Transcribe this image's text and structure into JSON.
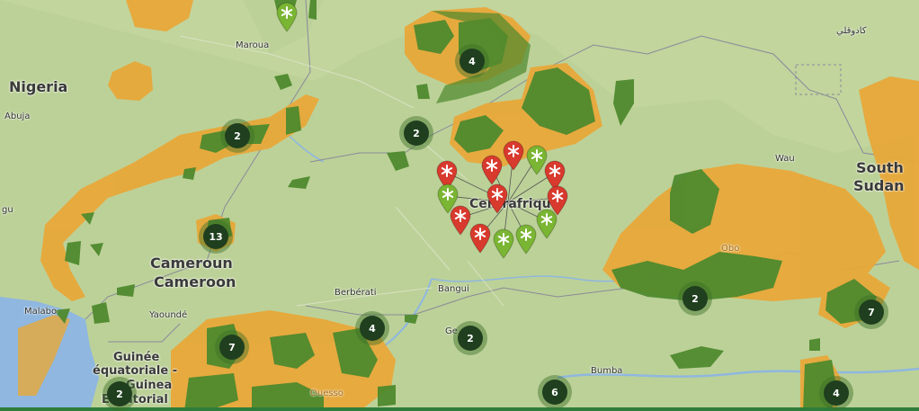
{
  "map": {
    "labels": {
      "nigeria": "Nigeria",
      "abuja": "Abuja",
      "maroua": "Maroua",
      "cameroun": "Cameroun",
      "cameroon": "Cameroon",
      "yaounde": "Yaoundé",
      "berberati": "Berbérati",
      "bangui": "Bangui",
      "centrafrique": "Centrafrique",
      "wau": "Wau",
      "south": "South",
      "sudan": "Sudan",
      "obo": "Obo",
      "kadugli": "كادوقلي",
      "malabo": "Malabo",
      "guinee": "Guinée",
      "equatoriale": "équatoriale -",
      "guinea": "Guinea",
      "ecuatorial": "Ecuatorial",
      "bumba": "Bumba",
      "ouesso": "Ouesso",
      "gemena": "Ge",
      "gu": "gu"
    },
    "clusters": [
      {
        "id": "c1",
        "count": "4"
      },
      {
        "id": "c2",
        "count": "2"
      },
      {
        "id": "c3",
        "count": "2"
      },
      {
        "id": "c4",
        "count": "13"
      },
      {
        "id": "c5",
        "count": "7"
      },
      {
        "id": "c6",
        "count": "4"
      },
      {
        "id": "c7",
        "count": "2"
      },
      {
        "id": "c8",
        "count": "2"
      },
      {
        "id": "c9",
        "count": "7"
      },
      {
        "id": "c10",
        "count": "2"
      },
      {
        "id": "c11",
        "count": "6"
      },
      {
        "id": "c12",
        "count": "4"
      }
    ],
    "colors": {
      "land": "#b9cf95",
      "orange_zone": "#e8a83a",
      "green_zone": "#4f8a2e",
      "water": "#8fb7df",
      "marker_red": "#d83a2e",
      "marker_green": "#7ab533",
      "cluster": "#1f3f1e"
    },
    "marker_symbol": "asterisk-icon"
  }
}
